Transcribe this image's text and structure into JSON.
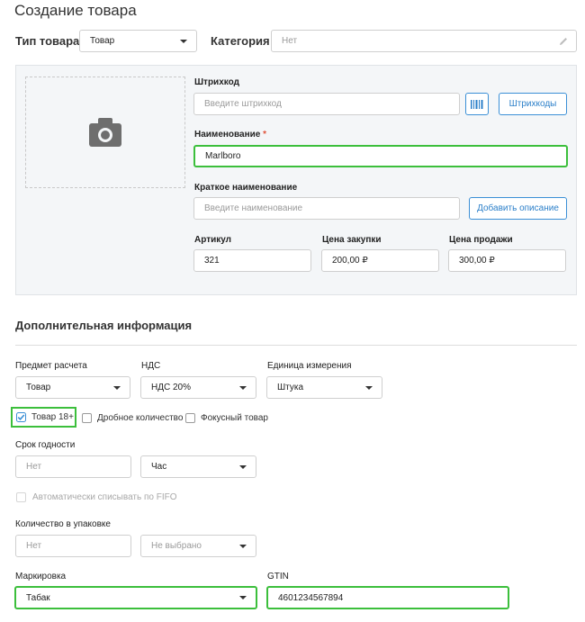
{
  "page_title": "Создание товара",
  "product_type": {
    "label": "Тип товара",
    "value": "Товар"
  },
  "category": {
    "label": "Категория",
    "value": "Нет"
  },
  "barcode": {
    "label": "Штрихкод",
    "placeholder": "Введите штрихкод",
    "barcodes_button": "Штрихкоды"
  },
  "name": {
    "label": "Наименование",
    "required_mark": "*",
    "value": "Marlboro"
  },
  "short_name": {
    "label": "Краткое наименование",
    "placeholder": "Введите наименование",
    "add_description_button": "Добавить описание"
  },
  "article": {
    "label": "Артикул",
    "value": "321"
  },
  "purchase_price": {
    "label": "Цена закупки",
    "value": "200,00 ₽"
  },
  "sale_price": {
    "label": "Цена продажи",
    "value": "300,00 ₽"
  },
  "additional_info_title": "Дополнительная информация",
  "payment_subject": {
    "label": "Предмет расчета",
    "value": "Товар"
  },
  "vat": {
    "label": "НДС",
    "value": "НДС 20%"
  },
  "unit": {
    "label": "Единица измерения",
    "value": "Штука"
  },
  "checkboxes": {
    "adult": {
      "label": "Товар 18+",
      "checked": true
    },
    "fractional": {
      "label": "Дробное количество",
      "checked": false
    },
    "focus": {
      "label": "Фокусный товар",
      "checked": false
    }
  },
  "shelf_life": {
    "label": "Срок годности",
    "value": "Нет",
    "unit": "Час"
  },
  "fifo": {
    "label": "Автоматически списывать по FIFO",
    "checked": false,
    "disabled": true
  },
  "package_qty": {
    "label": "Количество в упаковке",
    "value": "Нет",
    "unit": "Не выбрано"
  },
  "marking": {
    "label": "Маркировка",
    "value": "Табак"
  },
  "gtin": {
    "label": "GTIN",
    "value": "4601234567894"
  },
  "colors": {
    "accent": "#3b8fd6",
    "highlight": "#3cbf3c",
    "panel_bg": "#f4f6f8"
  }
}
